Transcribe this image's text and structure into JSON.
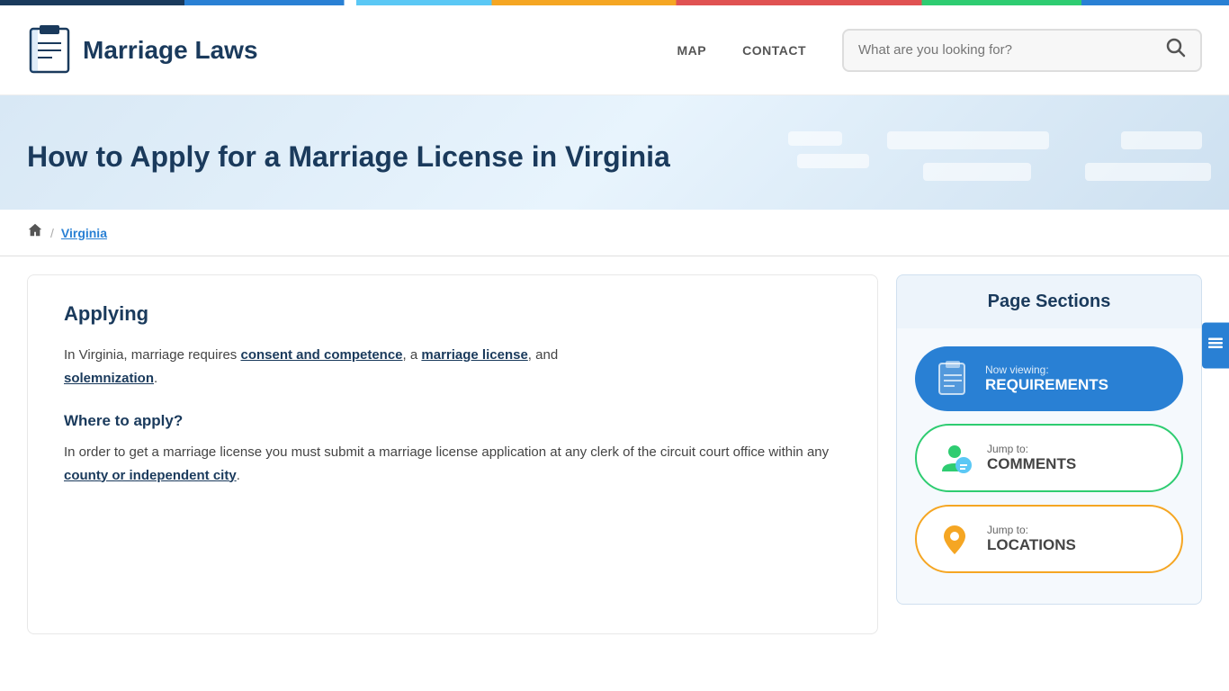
{
  "topBar": {},
  "header": {
    "logoTitle": "Marriage Laws",
    "nav": {
      "map": "MAP",
      "contact": "CONTACT"
    },
    "search": {
      "placeholder": "What are you looking for?"
    }
  },
  "hero": {
    "title": "How to Apply for a Marriage License in Virginia"
  },
  "breadcrumb": {
    "separator": "/",
    "current": "Virginia"
  },
  "article": {
    "heading": "Applying",
    "intro": "In Virginia, marriage requires ",
    "link1": "consent and competence",
    "mid1": ", a ",
    "link2": "marriage license",
    "mid2": ", and",
    "link3": "solemnization",
    "end": ".",
    "whereHeading": "Where to apply?",
    "whereText1": "In order to get a marriage license you must submit a marriage license application at any clerk of the circuit court office within any ",
    "whereLink": "county or independent city",
    "whereEnd": "."
  },
  "sidebar": {
    "title": "Page Sections",
    "sections": [
      {
        "id": "requirements",
        "status": "Now viewing:",
        "label": "REQUIREMENTS",
        "type": "active"
      },
      {
        "id": "comments",
        "status": "Jump to:",
        "label": "COMMENTS",
        "type": "comments"
      },
      {
        "id": "locations",
        "status": "Jump to:",
        "label": "LOCATIONS",
        "type": "locations"
      }
    ]
  },
  "floatingToggle": "☰"
}
